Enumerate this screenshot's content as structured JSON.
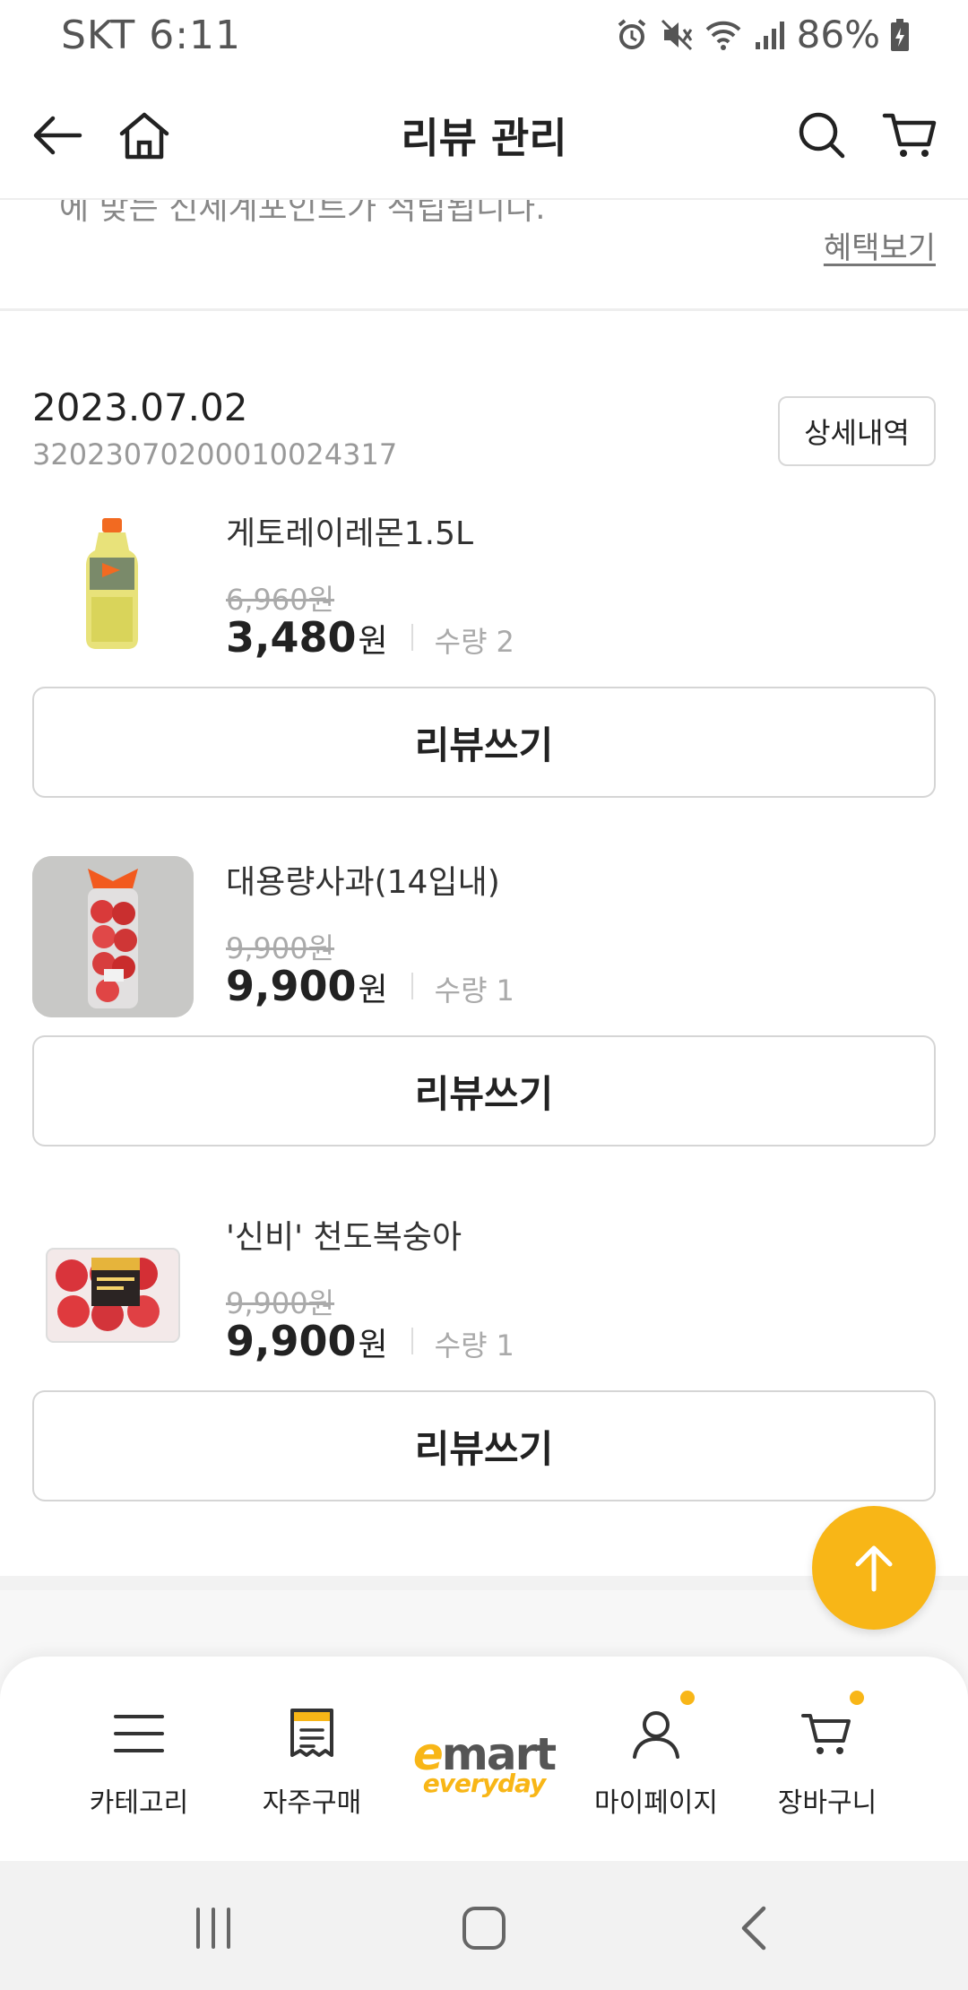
{
  "status_bar": {
    "carrier_time": "SKT 6:11",
    "battery": "86%"
  },
  "header": {
    "title": "리뷰 관리"
  },
  "notice": {
    "cut_text": "에 맞는 신세계포인트가 적립됩니다.",
    "benefit_link": "혜택보기"
  },
  "order": {
    "date": "2023.07.02",
    "order_number": "32023070200010024317",
    "detail_button": "상세내역"
  },
  "products": [
    {
      "name": "게토레이레몬1.5L",
      "original_price": "6,960원",
      "price": "3,480",
      "currency": "원",
      "qty_label": "수량",
      "qty": "2",
      "review_button": "리뷰쓰기"
    },
    {
      "name": "대용량사과(14입내)",
      "original_price": "9,900원",
      "price": "9,900",
      "currency": "원",
      "qty_label": "수량",
      "qty": "1",
      "review_button": "리뷰쓰기"
    },
    {
      "name": "'신비' 천도복숭아",
      "original_price": "9,900원",
      "price": "9,900",
      "currency": "원",
      "qty_label": "수량",
      "qty": "1",
      "review_button": "리뷰쓰기"
    }
  ],
  "bottom_nav": {
    "category": "카테고리",
    "frequent": "자주구매",
    "logo_main": "emart",
    "logo_sub": "everyday",
    "mypage": "마이페이지",
    "cart": "장바구니"
  },
  "colors": {
    "accent": "#f8b617",
    "text": "#222222",
    "muted": "#999999"
  }
}
